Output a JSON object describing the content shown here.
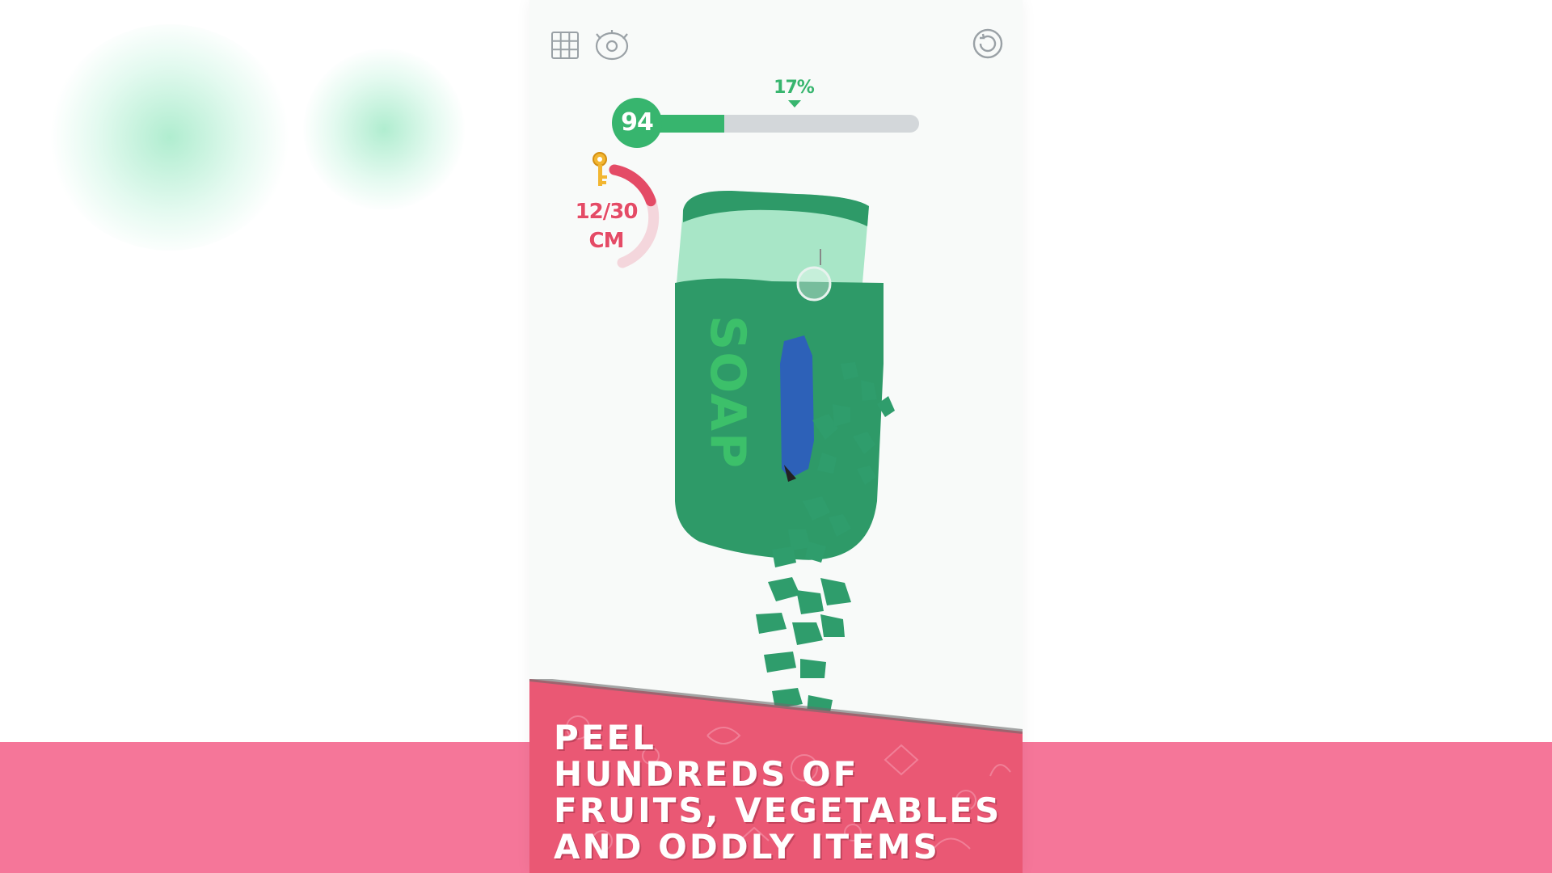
{
  "screen": {
    "background_color": "#ffffff",
    "band_color": "#f57699"
  },
  "toolbar": {
    "grid_icon": "grid-icon",
    "skin_icon": "skin-settings-icon",
    "restart_icon": "restart-icon"
  },
  "level": {
    "number": "94",
    "progress_percent_label": "17%",
    "progress_fraction": 0.28,
    "color": "#37b56e"
  },
  "length_gauge": {
    "current_label": "12/30",
    "unit_label": "CM",
    "fraction": 0.4,
    "key_icon": "key-icon",
    "color": "#e44b66"
  },
  "object": {
    "label": "SOAP",
    "color": "#2e9a68",
    "light_color": "#9fe0c0"
  },
  "banner": {
    "lines": [
      "PEEL",
      "HUNDREDS OF",
      "FRUITS, VEGETABLES",
      "AND ODDLY ITEMS"
    ],
    "color": "#ea5874"
  }
}
